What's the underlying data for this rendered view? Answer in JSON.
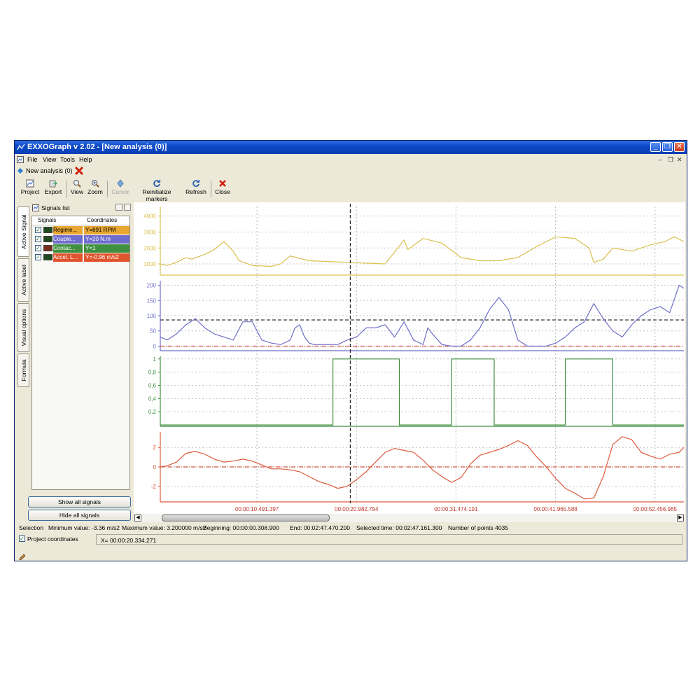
{
  "window": {
    "title": "EXXOGraph v 2.02 - [New analysis (0)]"
  },
  "menu": [
    "File",
    "View",
    "Tools",
    "Help"
  ],
  "document_tab": {
    "label": "New analysis (0)"
  },
  "toolbar": {
    "project": "Project",
    "export": "Export",
    "view": "View",
    "zoom": "Zoom",
    "cursor": "Cursor",
    "reinit": "Reinitialize markers",
    "refresh": "Refresh",
    "close": "Close"
  },
  "side_tabs": [
    "Active Signal",
    "Active label",
    "Visual options",
    "Formula"
  ],
  "signals_panel": {
    "title": "Signals list",
    "col_signals": "Signals",
    "col_coordinates": "Coordinates",
    "rows": [
      {
        "name": "Regime...",
        "coord": "Y=891 RPM",
        "color": "#e8a733"
      },
      {
        "name": "Couple...",
        "coord": "Y=20 N.m",
        "color": "#6f6ccf"
      },
      {
        "name": "Contac...",
        "coord": "Y=1",
        "color": "#3f9040"
      },
      {
        "name": "Accel. L...",
        "coord": "Y=-0.96 m/s2",
        "color": "#e0552e"
      }
    ],
    "show_all": "Show all signals",
    "hide_all": "Hide all signals"
  },
  "status": {
    "selection": "Selection",
    "min": "Minimum value: -3.36 m/s2",
    "max": "Maximum value: 3.200000 m/s2",
    "beginning": "Beginning: 00:00:00.308.900",
    "end": "End: 00:02:47.470.200",
    "selected": "Selected time: 00:02:47.161.300",
    "points": "Number of points 4035"
  },
  "coords": {
    "checkbox_label": "Project coordinates",
    "x_readout": "X= 00:00:20.334.271"
  },
  "chart_data": {
    "type": "line",
    "x_axis": {
      "unit": "time",
      "tick_labels": [
        "00:00:10.491.397",
        "00:00:20.982.794",
        "00:00:31.474.191",
        "00:00:41.965.588",
        "00:00:52.456.985"
      ],
      "tick_values_s": [
        10.491,
        20.983,
        31.474,
        41.966,
        52.457
      ],
      "range_s": [
        0.3,
        55.5
      ],
      "cursor_s": 20.33
    },
    "grid": true,
    "series": [
      {
        "color": "#d9c04f",
        "yticks": [
          1000,
          2000,
          3000,
          4000
        ],
        "ylim": [
          300,
          4600
        ],
        "x": [
          0.3,
          1,
          2,
          3,
          3.6,
          5,
          6,
          7,
          8,
          8.6,
          10,
          12,
          13,
          14,
          16,
          18,
          20,
          22,
          24,
          26,
          26.4,
          28,
          30,
          32,
          34,
          36,
          38,
          40,
          42,
          44,
          45.5,
          46,
          47,
          48,
          50,
          52,
          53.5,
          54.5,
          55.5
        ],
        "y": [
          1000,
          900,
          1100,
          1400,
          1300,
          1600,
          1900,
          2400,
          1800,
          1200,
          900,
          850,
          1000,
          1500,
          1200,
          1150,
          1100,
          1050,
          1000,
          2500,
          1900,
          2600,
          2300,
          1400,
          1200,
          1200,
          1400,
          2100,
          2700,
          2600,
          2000,
          1100,
          1300,
          2000,
          1800,
          2200,
          2400,
          2700,
          2400
        ]
      },
      {
        "color": "#6d6ec9",
        "yticks": [
          0,
          50,
          100,
          150,
          200
        ],
        "ylim": [
          -15,
          215
        ],
        "reference_lines": [
          86,
          0
        ],
        "x": [
          0.3,
          1,
          2,
          3,
          4,
          5,
          6,
          7,
          8,
          9,
          10,
          11,
          12,
          13,
          14,
          14.5,
          15,
          15.5,
          16,
          16.5,
          17,
          18,
          19,
          20,
          21,
          22,
          23,
          24,
          25,
          26,
          27,
          28,
          28.5,
          29,
          30,
          31,
          32,
          33,
          34,
          35,
          36,
          37,
          38,
          39,
          40,
          41,
          42,
          43,
          44,
          45,
          46,
          47,
          48,
          49,
          50,
          51,
          52,
          53,
          54,
          55,
          55.5
        ],
        "y": [
          30,
          20,
          40,
          70,
          90,
          60,
          40,
          30,
          20,
          80,
          80,
          20,
          10,
          5,
          20,
          60,
          70,
          30,
          10,
          5,
          5,
          5,
          5,
          20,
          30,
          60,
          60,
          70,
          30,
          80,
          20,
          5,
          60,
          40,
          5,
          0,
          0,
          20,
          60,
          120,
          160,
          120,
          20,
          0,
          0,
          0,
          10,
          30,
          60,
          80,
          140,
          90,
          50,
          30,
          70,
          100,
          120,
          130,
          110,
          200,
          190
        ]
      },
      {
        "color": "#3e8f3e",
        "yticks": [
          0.2,
          0.4,
          0.6,
          0.8,
          1
        ],
        "ytick_labels": [
          "0,2",
          "0,4",
          "0,6",
          "0,8",
          "1"
        ],
        "ylim": [
          -0.02,
          1.04
        ],
        "x": [
          0.3,
          18.5,
          18.5,
          25.5,
          25.5,
          31.0,
          31.0,
          35.5,
          35.5,
          43.0,
          43.0,
          48.0,
          48.0,
          55.5
        ],
        "y": [
          0,
          0,
          1,
          1,
          0,
          0,
          1,
          1,
          0,
          0,
          1,
          1,
          0,
          0
        ]
      },
      {
        "color": "#de5a3c",
        "yticks": [
          -2,
          0,
          2
        ],
        "ylim": [
          -3.6,
          3.6
        ],
        "reference_lines": [
          0
        ],
        "x": [
          0.3,
          1,
          2,
          3,
          4,
          5,
          6,
          7,
          8,
          9,
          10,
          11,
          12,
          13,
          14,
          15,
          16,
          17,
          18,
          19,
          20,
          21,
          22,
          23,
          24,
          25,
          26,
          27,
          28,
          29,
          30,
          31,
          32,
          33,
          34,
          35,
          36,
          37,
          38,
          39,
          40,
          41,
          42,
          43,
          44,
          45,
          46,
          47,
          48,
          49,
          50,
          51,
          52,
          53,
          54,
          55,
          55.5
        ],
        "y": [
          0,
          0.1,
          0.5,
          1.4,
          1.6,
          1.3,
          0.8,
          0.5,
          0.6,
          0.8,
          0.6,
          0.2,
          -0.2,
          -0.2,
          -0.3,
          -0.5,
          -1.0,
          -1.5,
          -1.8,
          -2.2,
          -2.0,
          -1.3,
          -0.5,
          0.5,
          1.5,
          1.9,
          1.7,
          1.5,
          0.7,
          -0.3,
          -1.0,
          -1.6,
          -1.1,
          0.3,
          1.2,
          1.5,
          1.8,
          2.2,
          2.7,
          2.2,
          1.0,
          0,
          -1.2,
          -2.2,
          -2.7,
          -3.3,
          -3.2,
          -1.0,
          2.3,
          3.1,
          2.8,
          1.5,
          1.1,
          0.8,
          1.3,
          1.5,
          2.0
        ]
      }
    ]
  }
}
